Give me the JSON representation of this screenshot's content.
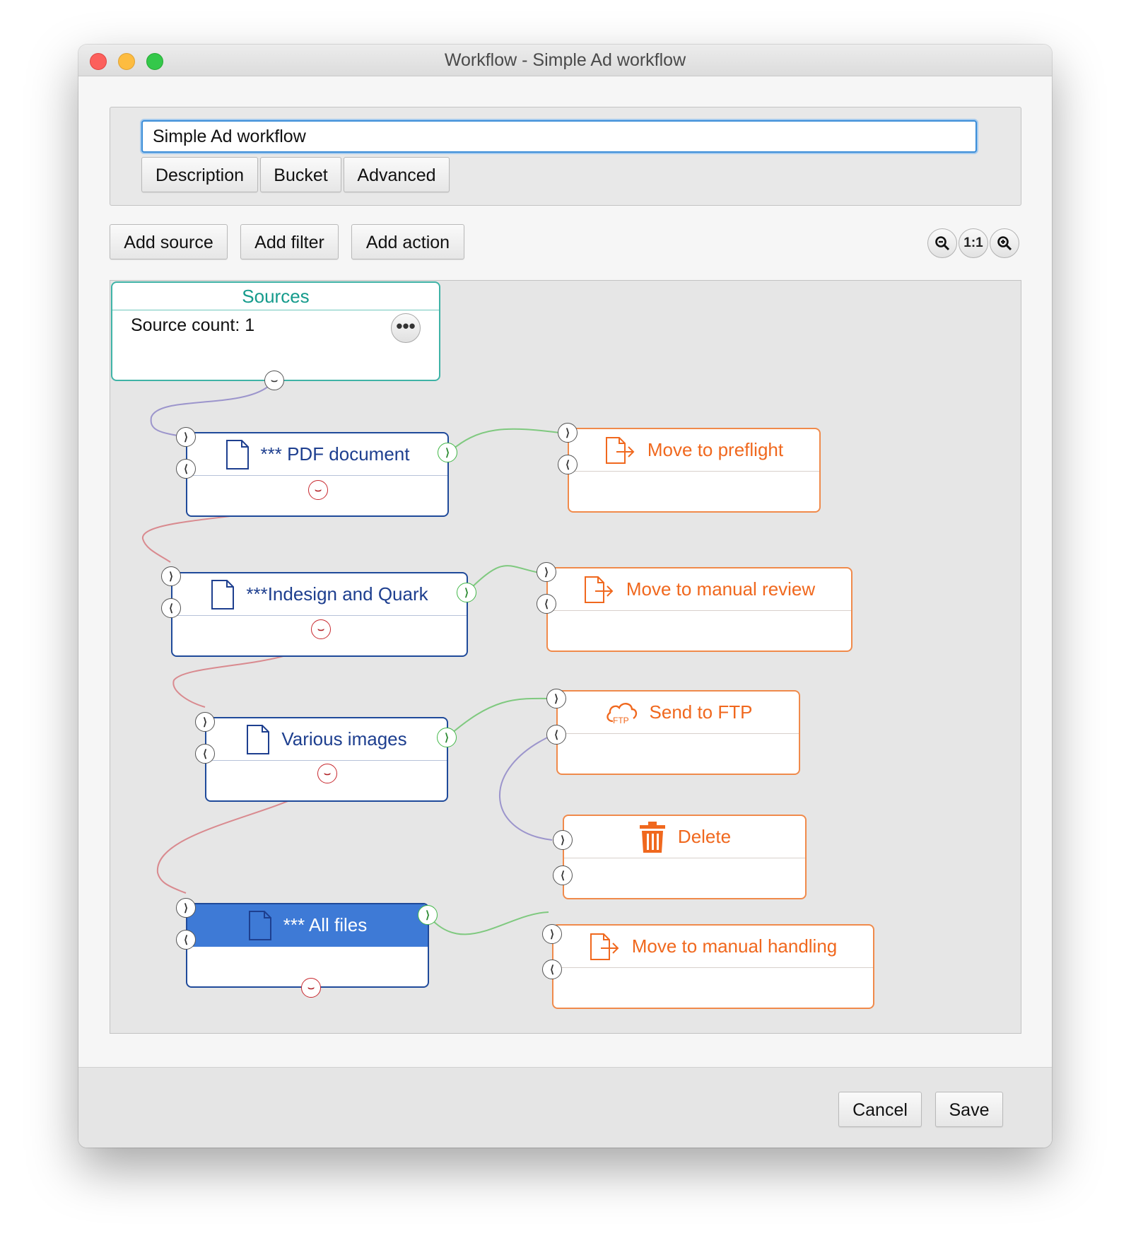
{
  "window": {
    "title": "Workflow - Simple Ad workflow"
  },
  "workflow": {
    "name_value": "Simple Ad workflow"
  },
  "tabs": [
    "Description",
    "Bucket",
    "Advanced"
  ],
  "toolbar": {
    "add_source": "Add source",
    "add_filter": "Add filter",
    "add_action": "Add action",
    "zoom_reset_label": "1:1"
  },
  "sources": {
    "title": "Sources",
    "count_text": "Source count: 1",
    "more_label": "•••"
  },
  "filters": [
    {
      "label": "*** PDF document",
      "icon": "document-icon"
    },
    {
      "label": "***Indesign and Quark",
      "icon": "document-icon"
    },
    {
      "label": "Various images",
      "icon": "document-icon"
    },
    {
      "label": "*** All files",
      "icon": "document-icon",
      "selected": true
    }
  ],
  "actions": [
    {
      "label": "Move to preflight",
      "icon": "move-file-icon"
    },
    {
      "label": "Move to manual review",
      "icon": "move-file-icon"
    },
    {
      "label": "Send to FTP",
      "icon": "ftp-cloud-icon",
      "icon_text": "FTP"
    },
    {
      "label": "Delete",
      "icon": "trash-icon"
    },
    {
      "label": "Move to manual handling",
      "icon": "move-file-icon"
    }
  ],
  "ports": {
    "in_glyph": "⟩",
    "reject_glyph": "⟨",
    "down_glyph": "⌣",
    "out_glyph": "⟩"
  },
  "footer": {
    "cancel": "Cancel",
    "save": "Save"
  },
  "colors": {
    "filter": "#1f4a9a",
    "action": "#f08a4b",
    "sources": "#3fb3a6",
    "accept_wire": "#7fc97f",
    "reject_wire": "#d98a8f",
    "reject_link": "#9c95cc",
    "selected": "#3e7ad6"
  }
}
